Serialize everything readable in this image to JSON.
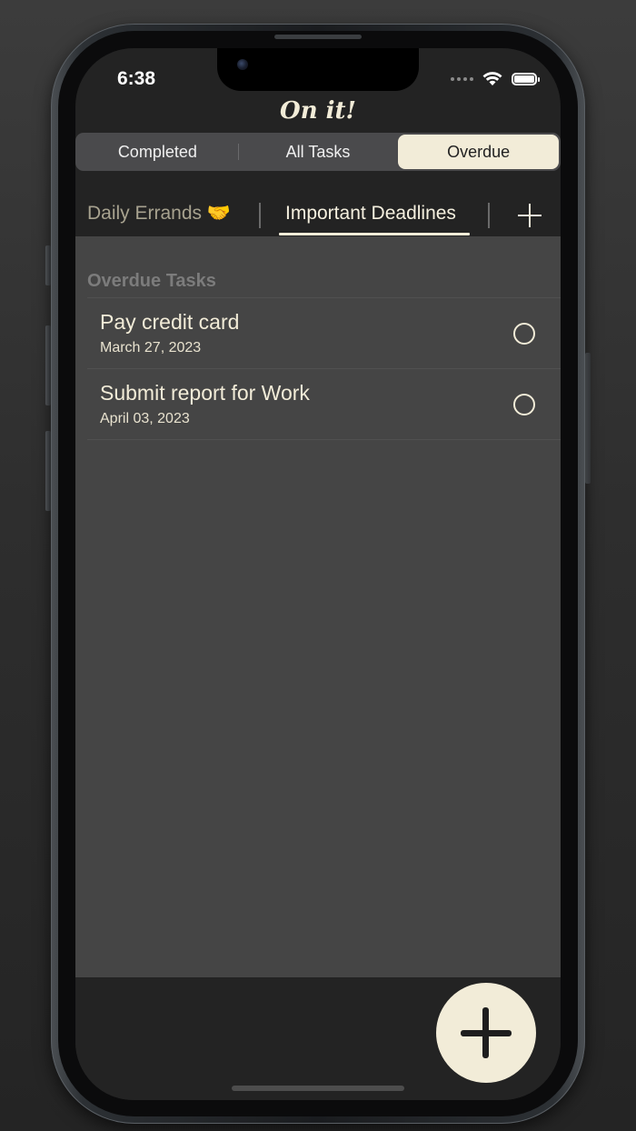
{
  "status_bar": {
    "time": "6:38"
  },
  "app": {
    "title": "On it!"
  },
  "filter_segments": [
    {
      "label": "Completed",
      "active": false
    },
    {
      "label": "All Tasks",
      "active": false
    },
    {
      "label": "Overdue",
      "active": true
    }
  ],
  "projects": {
    "tabs": [
      {
        "label": "Daily Errands 🤝",
        "active": false
      },
      {
        "label": "Important Deadlines",
        "active": true
      }
    ],
    "add_icon": "plus-icon"
  },
  "section": {
    "header": "Overdue Tasks"
  },
  "tasks": [
    {
      "title": "Pay credit card",
      "date": "March 27, 2023",
      "completed": false
    },
    {
      "title": "Submit report for Work",
      "date": "April 03, 2023",
      "completed": false
    }
  ],
  "fab": {
    "icon": "plus-icon"
  },
  "colors": {
    "accent": "#f2ecd8",
    "background": "#232323",
    "content_background": "#454545"
  }
}
